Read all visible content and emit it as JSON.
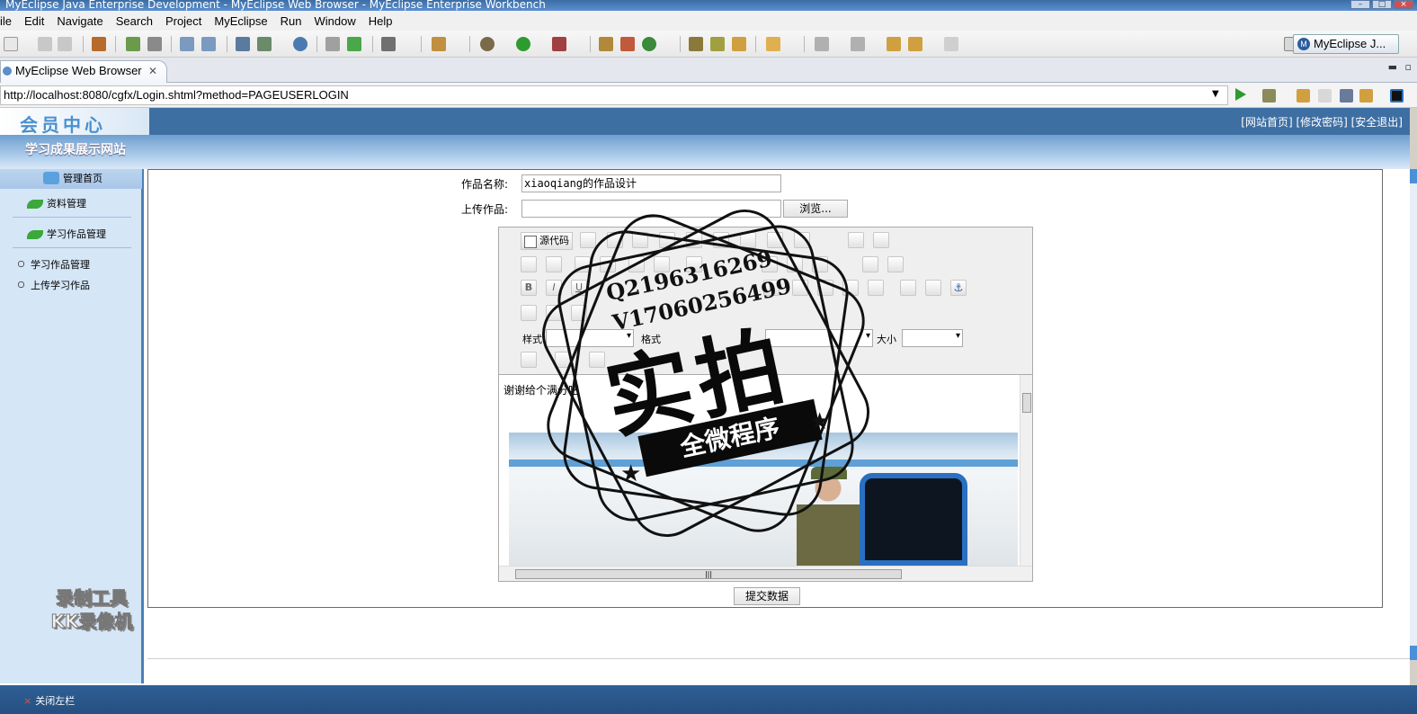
{
  "window": {
    "title": "MyEclipse Java Enterprise Development - MyEclipse Web Browser - MyEclipse Enterprise Workbench"
  },
  "menu": [
    "ile",
    "Edit",
    "Navigate",
    "Search",
    "Project",
    "MyEclipse",
    "Run",
    "Window",
    "Help"
  ],
  "toolbar": {
    "perspective_label": "MyEclipse J..."
  },
  "editor_tab": {
    "label": "MyEclipse Web Browser",
    "close": "✕"
  },
  "browser": {
    "url": "http://localhost:8080/cgfx/Login.shtml?method=PAGEUSERLOGIN"
  },
  "site": {
    "logo": "会员中心",
    "subtitle": "学习成果展示网站",
    "header_links": "[网站首页] [修改密码] [安全退出]",
    "nav_home": "管理首页",
    "nav_sections": [
      "资料管理",
      "学习作品管理"
    ],
    "nav_items": [
      "学习作品管理",
      "上传学习作品"
    ],
    "footer_close": "关闭左栏"
  },
  "form": {
    "name_label": "作品名称:",
    "name_value": "xiaoqiang的作品设计",
    "upload_label": "上传作品:",
    "browse_button": "浏览...",
    "source_button": "源代码",
    "style_label": "样式",
    "format_label": "格式",
    "size_label": "大小",
    "editor_content": "谢谢给个满分吧",
    "submit_button": "提交数据"
  },
  "watermark": {
    "recorder_line1": "录制工具",
    "recorder_line2": "KK录像机",
    "stamp_line1": "Q2196316269",
    "stamp_line2": "V17060256499",
    "stamp_big": "实拍",
    "stamp_ribbon": "全微程序"
  },
  "colors": {
    "header_blue": "#3e6fa3",
    "nav_bg": "#d5e6f7",
    "status_bar": "#2f5f95"
  }
}
